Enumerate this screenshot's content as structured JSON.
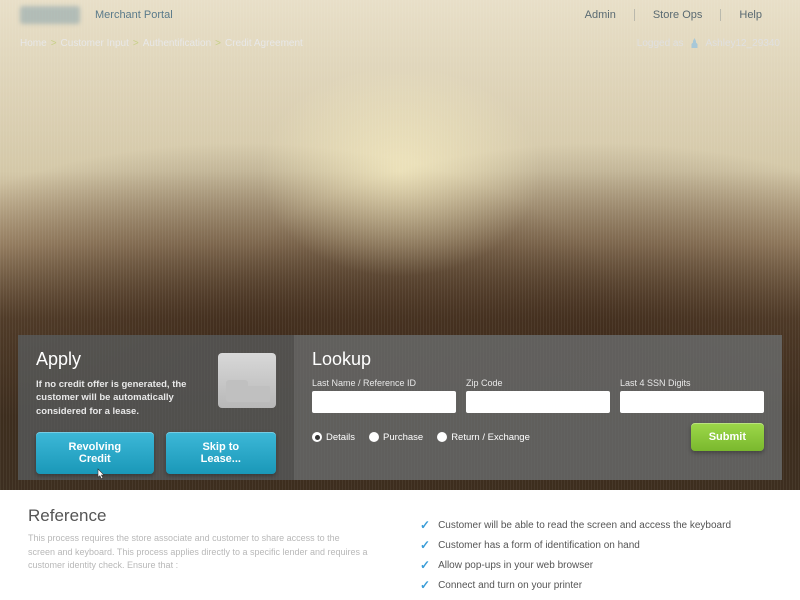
{
  "header": {
    "portal_label": "Merchant Portal",
    "nav": [
      "Admin",
      "Store Ops",
      "Help"
    ]
  },
  "breadcrumb": {
    "items": [
      "Home",
      "Customer Input",
      "Authentification",
      "Credit Agreement"
    ],
    "logged_prefix": "Logged as",
    "username": "Ashley12_29340"
  },
  "apply": {
    "title": "Apply",
    "description": "If no credit offer is generated, the customer will be automatically considered for a lease.",
    "btn_revolving": "Revolving Credit",
    "btn_skip": "Skip to Lease..."
  },
  "lookup": {
    "title": "Lookup",
    "label_lastname": "Last Name / Reference ID",
    "label_zip": "Zip Code",
    "label_ssn": "Last 4 SSN Digits",
    "radio_details": "Details",
    "radio_purchase": "Purchase",
    "radio_return": "Return / Exchange",
    "btn_submit": "Submit"
  },
  "reference": {
    "title": "Reference",
    "body": "This process requires the store associate and customer to share access to the screen and keyboard. This process applies directly to a specific lender and requires a customer identity check. Ensure that :",
    "checklist": [
      "Customer will be able to read the screen and access the keyboard",
      "Customer has a form of identification on hand",
      "Allow pop-ups in your web browser",
      "Connect and turn on your printer"
    ]
  }
}
